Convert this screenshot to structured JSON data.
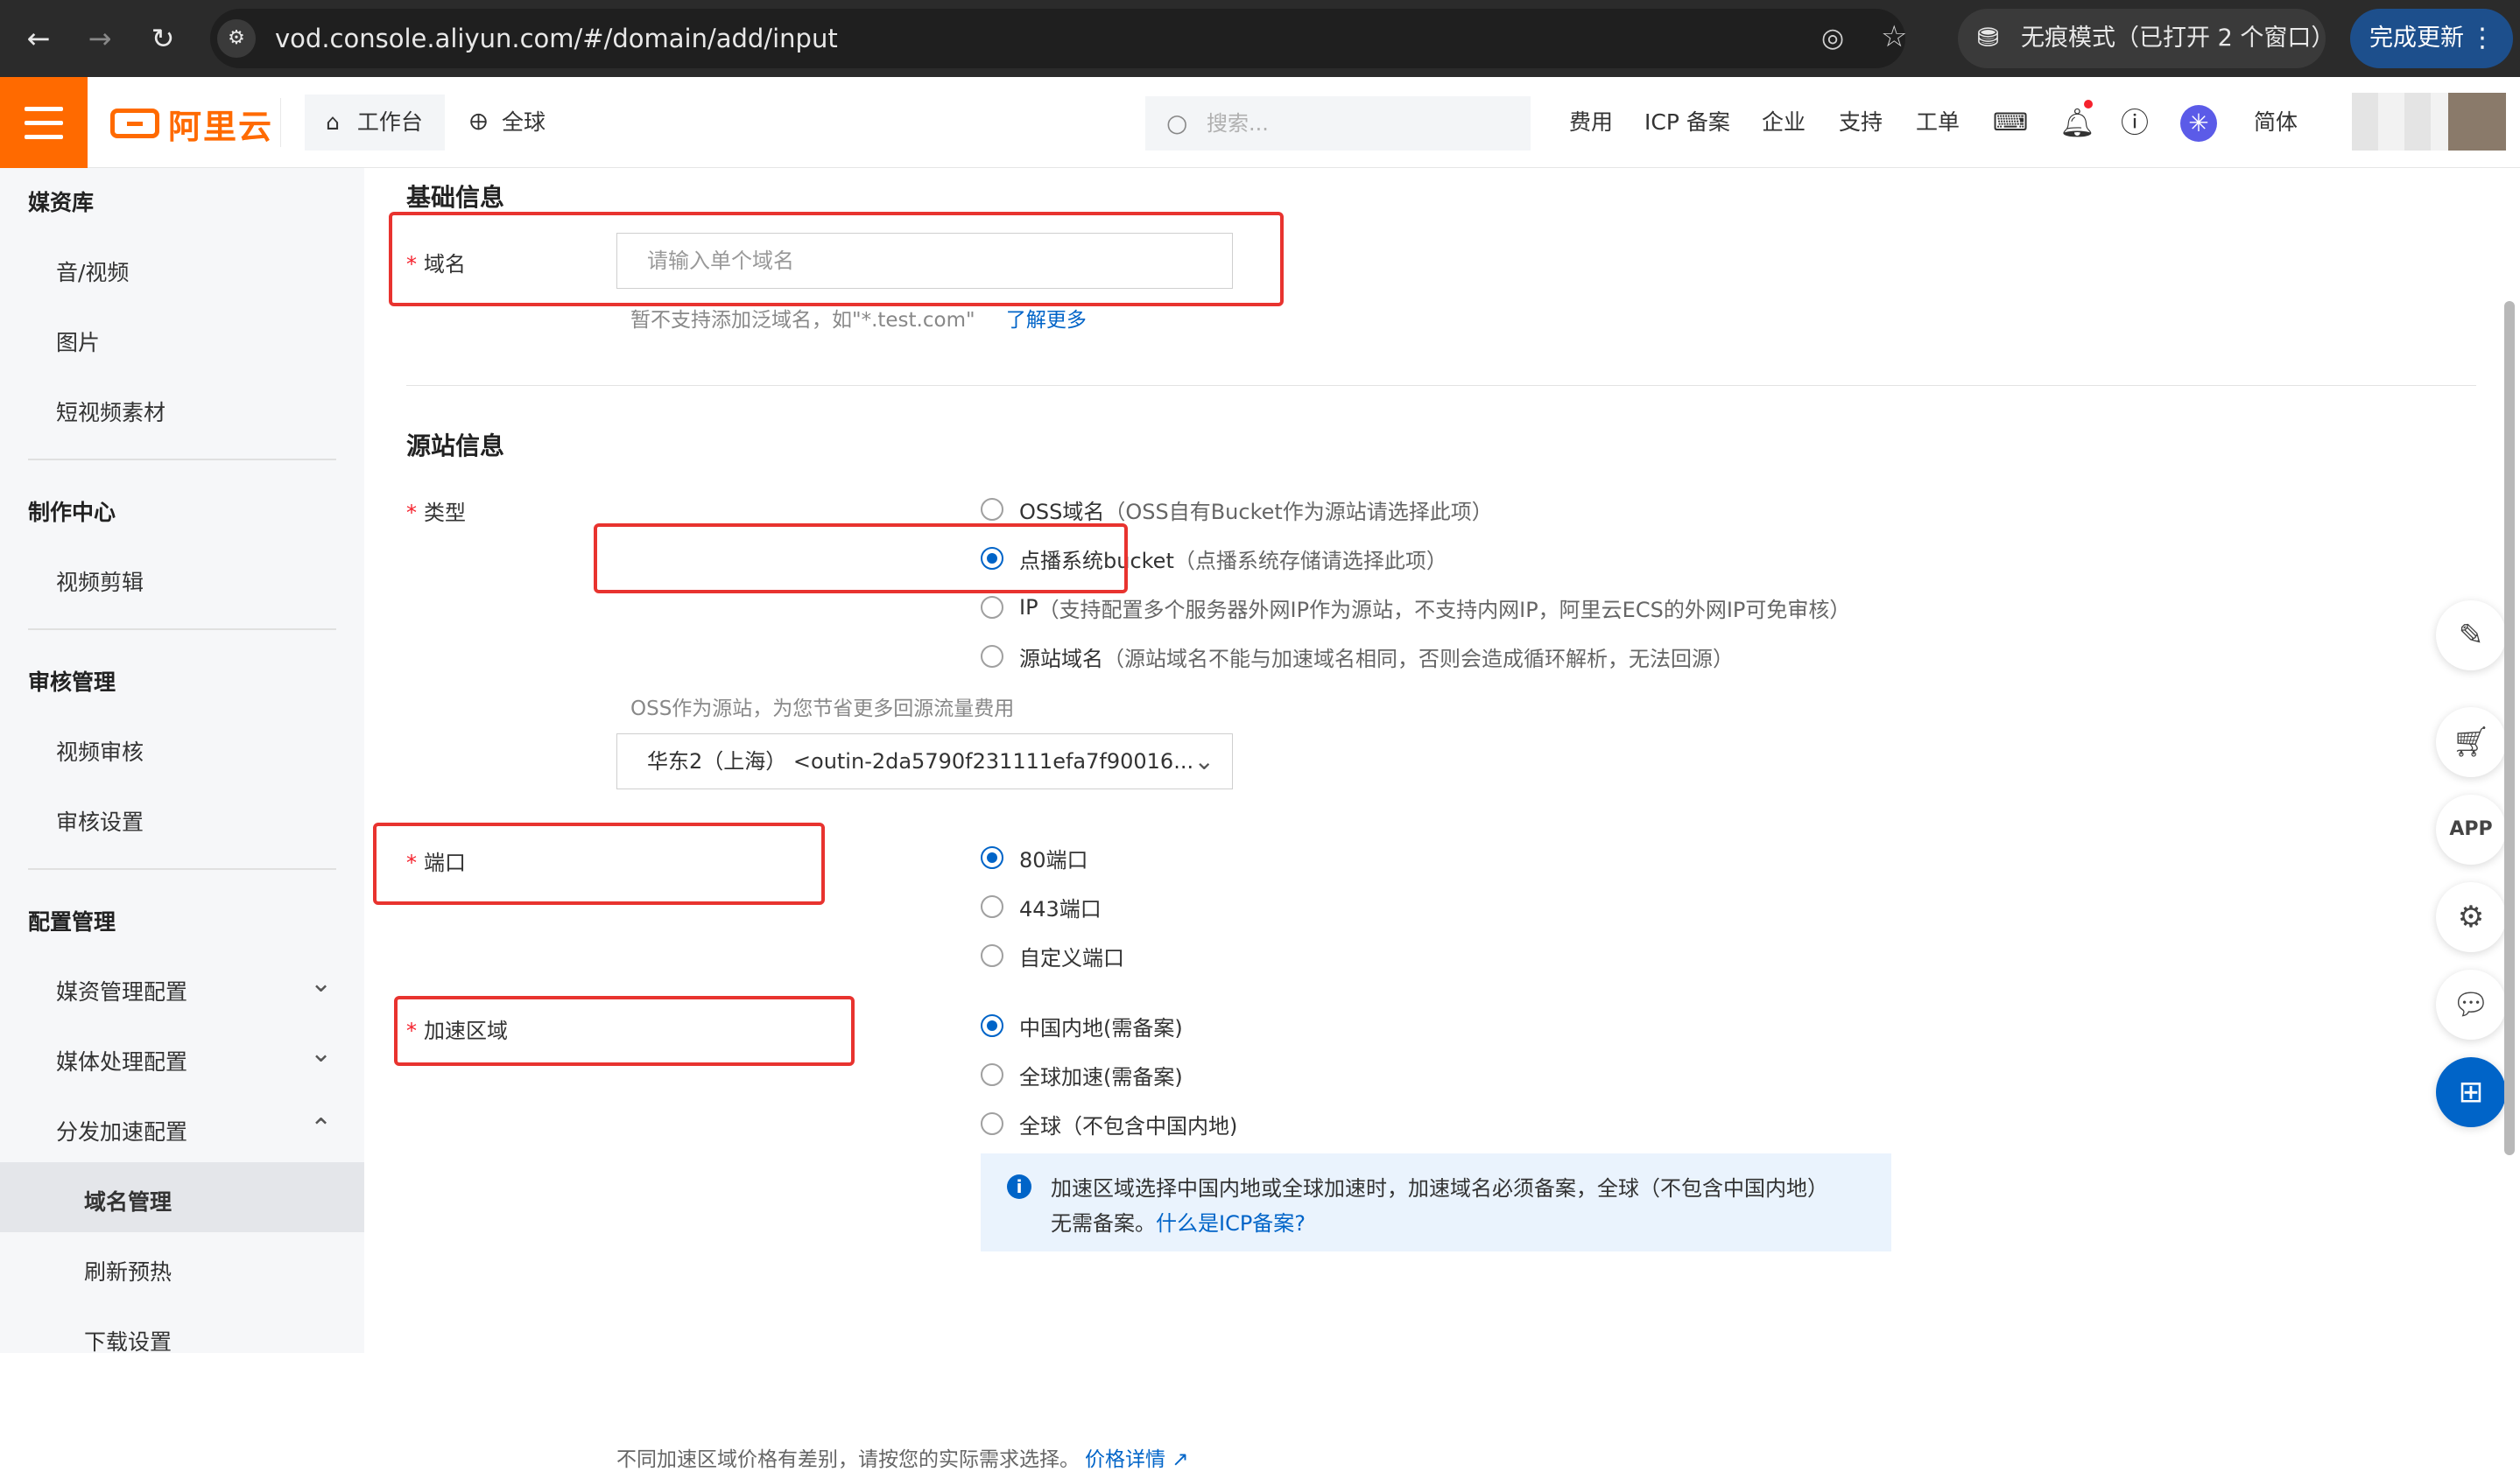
{
  "browser": {
    "back_icon": "arrow-left-icon",
    "url": "vod.console.aliyun.com/#/domain/add/input",
    "incognito_label": "无痕模式（已打开 2 个窗口）",
    "update_label": "完成更新"
  },
  "topnav": {
    "logo_text": "阿里云",
    "workbench": "工作台",
    "region": "全球",
    "search_placeholder": "搜索...",
    "links": [
      "费用",
      "ICP 备案",
      "企业",
      "支持",
      "工单"
    ],
    "lang": "简体",
    "brand_color": "#ff6a00"
  },
  "sidebar": {
    "groups": [
      {
        "title": "媒资库",
        "items": [
          "音/视频",
          "图片",
          "短视频素材"
        ]
      },
      {
        "title": "制作中心",
        "items": [
          "视频剪辑"
        ]
      },
      {
        "title": "审核管理",
        "items": [
          "视频审核",
          "审核设置"
        ]
      },
      {
        "title": "配置管理",
        "items": [
          "媒资管理配置",
          "媒体处理配置",
          "分发加速配置"
        ]
      }
    ],
    "subitems": [
      "域名管理",
      "刷新预热",
      "下载设置"
    ],
    "active": "域名管理"
  },
  "form": {
    "basic_title": "基础信息",
    "domain_label": "域名",
    "domain_placeholder": "请输入单个域名",
    "domain_hint": "暂不支持添加泛域名，如\"*.test.com\"",
    "learn_more": "了解更多",
    "origin_title": "源站信息",
    "type_label": "类型",
    "type_options": [
      {
        "label": "OSS域名",
        "note": "（OSS自有Bucket作为源站请选择此项）",
        "selected": false
      },
      {
        "label": "点播系统bucket",
        "note": "（点播系统存储请选择此项）",
        "selected": true
      },
      {
        "label": "IP",
        "note": "（支持配置多个服务器外网IP作为源站，不支持内网IP，阿里云ECS的外网IP可免审核）",
        "selected": false
      },
      {
        "label": "源站域名",
        "note": "（源站域名不能与加速域名相同，否则会造成循环解析，无法回源）",
        "selected": false
      }
    ],
    "oss_hint": "OSS作为源站，为您节省更多回源流量费用",
    "bucket_select": "华东2（上海） <outin-2da5790f231111efa7f90016...",
    "port_label": "端口",
    "port_options": [
      {
        "label": "80端口",
        "selected": true
      },
      {
        "label": "443端口",
        "selected": false
      },
      {
        "label": "自定义端口",
        "selected": false
      }
    ],
    "area_label": "加速区域",
    "area_options": [
      {
        "label": "中国内地(需备案)",
        "selected": true
      },
      {
        "label": "全球加速(需备案)",
        "selected": false
      },
      {
        "label": "全球（不包含中国内地)",
        "selected": false
      }
    ],
    "info_line1": "加速区域选择中国内地或全球加速时，加速域名必须备案，全球（不包含中国内地）",
    "info_line2_text": "无需备案。",
    "info_line2_link": "什么是ICP备案?",
    "price_hint": "不同加速区域价格有差别，请按您的实际需求选择。",
    "price_link": "价格详情",
    "highlight_color": "#e8332f",
    "accent_color": "#0064c8"
  },
  "float_tools": [
    "edit-icon",
    "cart-icon",
    "app-icon",
    "settings-icon",
    "chat-icon",
    "grid-icon"
  ]
}
